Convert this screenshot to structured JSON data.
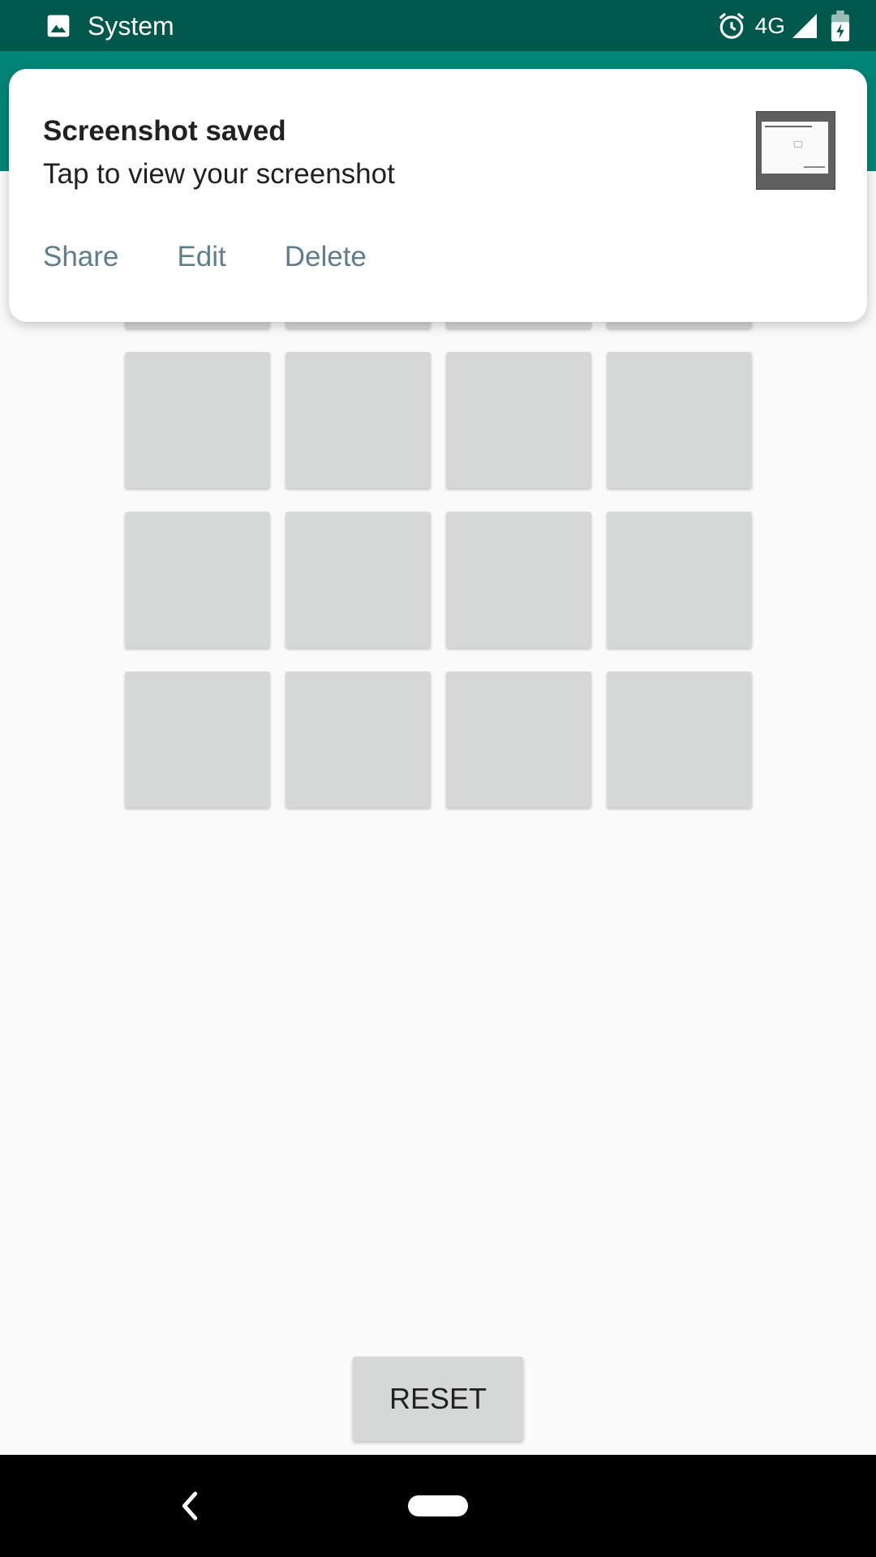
{
  "status_bar": {
    "notification_app": "System",
    "network": "4G",
    "icons": [
      "image-icon",
      "alarm-icon",
      "signal-icon",
      "battery-icon"
    ]
  },
  "notification": {
    "title": "Screenshot saved",
    "text": "Tap to view your screenshot",
    "actions": [
      "Share",
      "Edit",
      "Delete"
    ]
  },
  "grid": {
    "rows": 4,
    "columns": 4
  },
  "reset_button": {
    "label": "RESET"
  },
  "colors": {
    "status_bar": "#00574b",
    "app_bar": "#008577",
    "tile": "#d6d7d7",
    "action_text": "#607d8b"
  },
  "nav_bar": {
    "icons": [
      "back-icon",
      "home-pill-icon"
    ]
  }
}
